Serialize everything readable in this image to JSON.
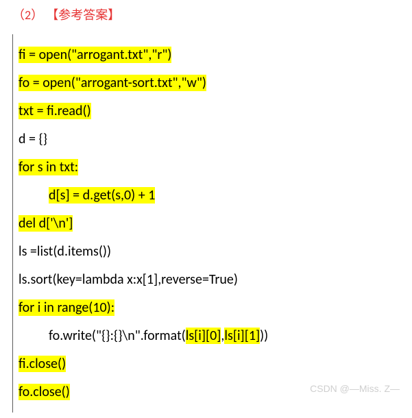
{
  "header": "（2） 【参考答案】",
  "code": {
    "lines": [
      {
        "indent": 0,
        "segments": [
          {
            "text": "fi = open(\"arrogant.txt\",\"r\")",
            "hl": true
          }
        ]
      },
      {
        "indent": 0,
        "segments": [
          {
            "text": "fo = open(\"arrogant-sort.txt\",\"w\")",
            "hl": true
          }
        ]
      },
      {
        "indent": 0,
        "segments": [
          {
            "text": "txt = fi.read()",
            "hl": true
          }
        ]
      },
      {
        "indent": 0,
        "segments": [
          {
            "text": "d = {}",
            "hl": false
          }
        ]
      },
      {
        "indent": 0,
        "segments": [
          {
            "text": "for s in txt:",
            "hl": true
          }
        ]
      },
      {
        "indent": 1,
        "segments": [
          {
            "text": "d[s] = d.get(s,0) + 1",
            "hl": true
          }
        ]
      },
      {
        "indent": 0,
        "segments": [
          {
            "text": "del d['\\n']",
            "hl": true
          }
        ]
      },
      {
        "indent": 0,
        "segments": [
          {
            "text": "ls =list(d.items())",
            "hl": false
          }
        ]
      },
      {
        "indent": 0,
        "segments": [
          {
            "text": "ls.sort(key=lambda x:x[1],reverse=True)",
            "hl": false
          }
        ]
      },
      {
        "indent": 0,
        "segments": [
          {
            "text": "for i in range(10):",
            "hl": true
          }
        ]
      },
      {
        "indent": 1,
        "segments": [
          {
            "text": "fo.write(\"{}:{}\\n\".format(",
            "hl": false
          },
          {
            "text": "ls[i][0]",
            "hl": true
          },
          {
            "text": ",",
            "hl": false
          },
          {
            "text": "ls[i][1]",
            "hl": true
          },
          {
            "text": "))",
            "hl": false
          }
        ]
      },
      {
        "indent": 0,
        "segments": [
          {
            "text": "fi.close()",
            "hl": true
          }
        ]
      },
      {
        "indent": 0,
        "segments": [
          {
            "text": "fo.close()",
            "hl": true
          }
        ]
      }
    ]
  },
  "watermark": "CSDN @—Miss. Z—"
}
